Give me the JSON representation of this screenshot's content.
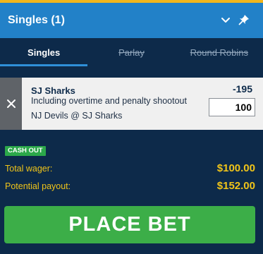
{
  "header": {
    "title": "Singles (1)",
    "icons": {
      "collapse": "chevron-down-icon",
      "pin": "pin-icon"
    }
  },
  "tabs": [
    {
      "label": "Singles",
      "active": true
    },
    {
      "label": "Parlay",
      "active": false
    },
    {
      "label": "Round Robins",
      "active": false
    }
  ],
  "selection": {
    "team": "SJ Sharks",
    "note": "Including overtime and penalty shootout",
    "match": "NJ Devils @ SJ Sharks",
    "odds": "-195",
    "wager": "100",
    "remove_icon": "close-icon"
  },
  "cashout_badge": "CASH OUT",
  "totals": {
    "wager_label": "Total wager:",
    "wager_value": "$100.00",
    "payout_label": "Potential payout:",
    "payout_value": "$152.00"
  },
  "place_bet": "PLACE BET",
  "colors": {
    "header": "#2281c8",
    "background": "#0d2a4a",
    "accent_yellow": "#f0c419",
    "button_green": "#3cae48",
    "cashout_green": "#2ca84a"
  }
}
